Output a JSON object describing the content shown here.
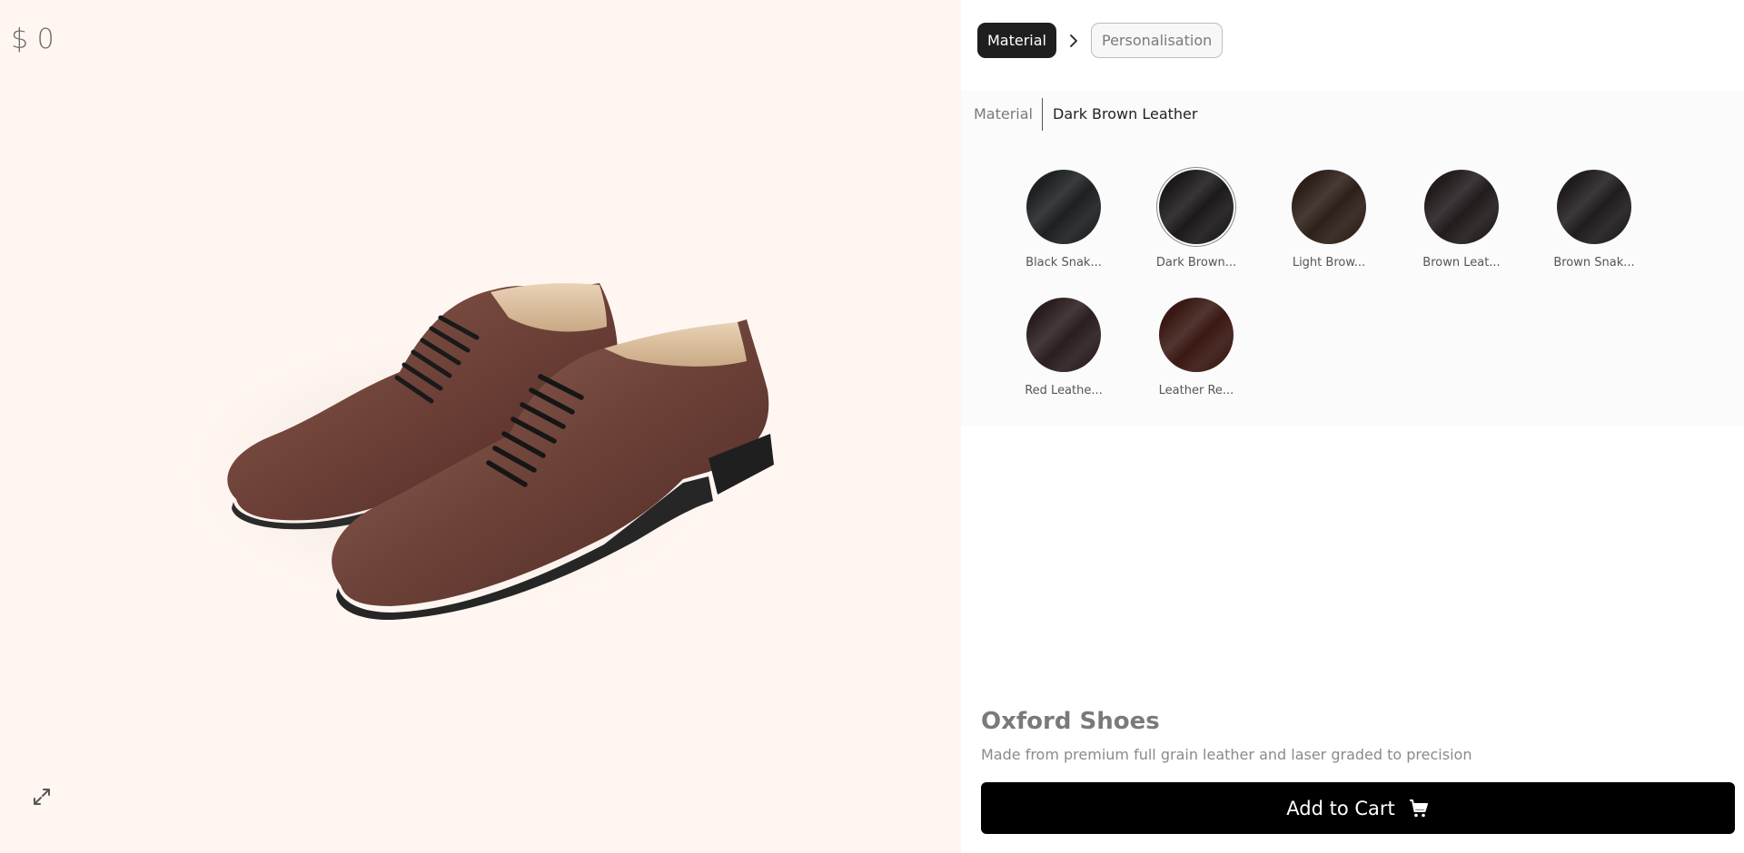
{
  "viewer": {
    "price": "$ 0",
    "expand_icon": "expand-icon",
    "background_color": "#fff6f1"
  },
  "steps": {
    "items": [
      {
        "label": "Material",
        "active": true
      },
      {
        "label": "Personalisation",
        "active": false
      }
    ],
    "separator_icon": "chevron-right-icon"
  },
  "material": {
    "label": "Material",
    "selected_value": "Dark Brown Leather",
    "options": [
      {
        "name": "Black Snak...",
        "color": "#1e2123",
        "selected": false
      },
      {
        "name": "Dark Brown...",
        "color": "#1c1a1b",
        "selected": true
      },
      {
        "name": "Light Brow...",
        "color": "#2e2019",
        "selected": false
      },
      {
        "name": "Brown Leat...",
        "color": "#221c1d",
        "selected": false
      },
      {
        "name": "Brown Snak...",
        "color": "#211d1e",
        "selected": false
      },
      {
        "name": "Red Leathe...",
        "color": "#2b1e1e",
        "selected": false
      },
      {
        "name": "Leather Re...",
        "color": "#3a1914",
        "selected": false
      }
    ]
  },
  "product": {
    "title": "Oxford Shoes",
    "description": "Made from premium full grain leather and laser graded to precision"
  },
  "cart": {
    "label": "Add to Cart",
    "icon": "cart-icon"
  }
}
